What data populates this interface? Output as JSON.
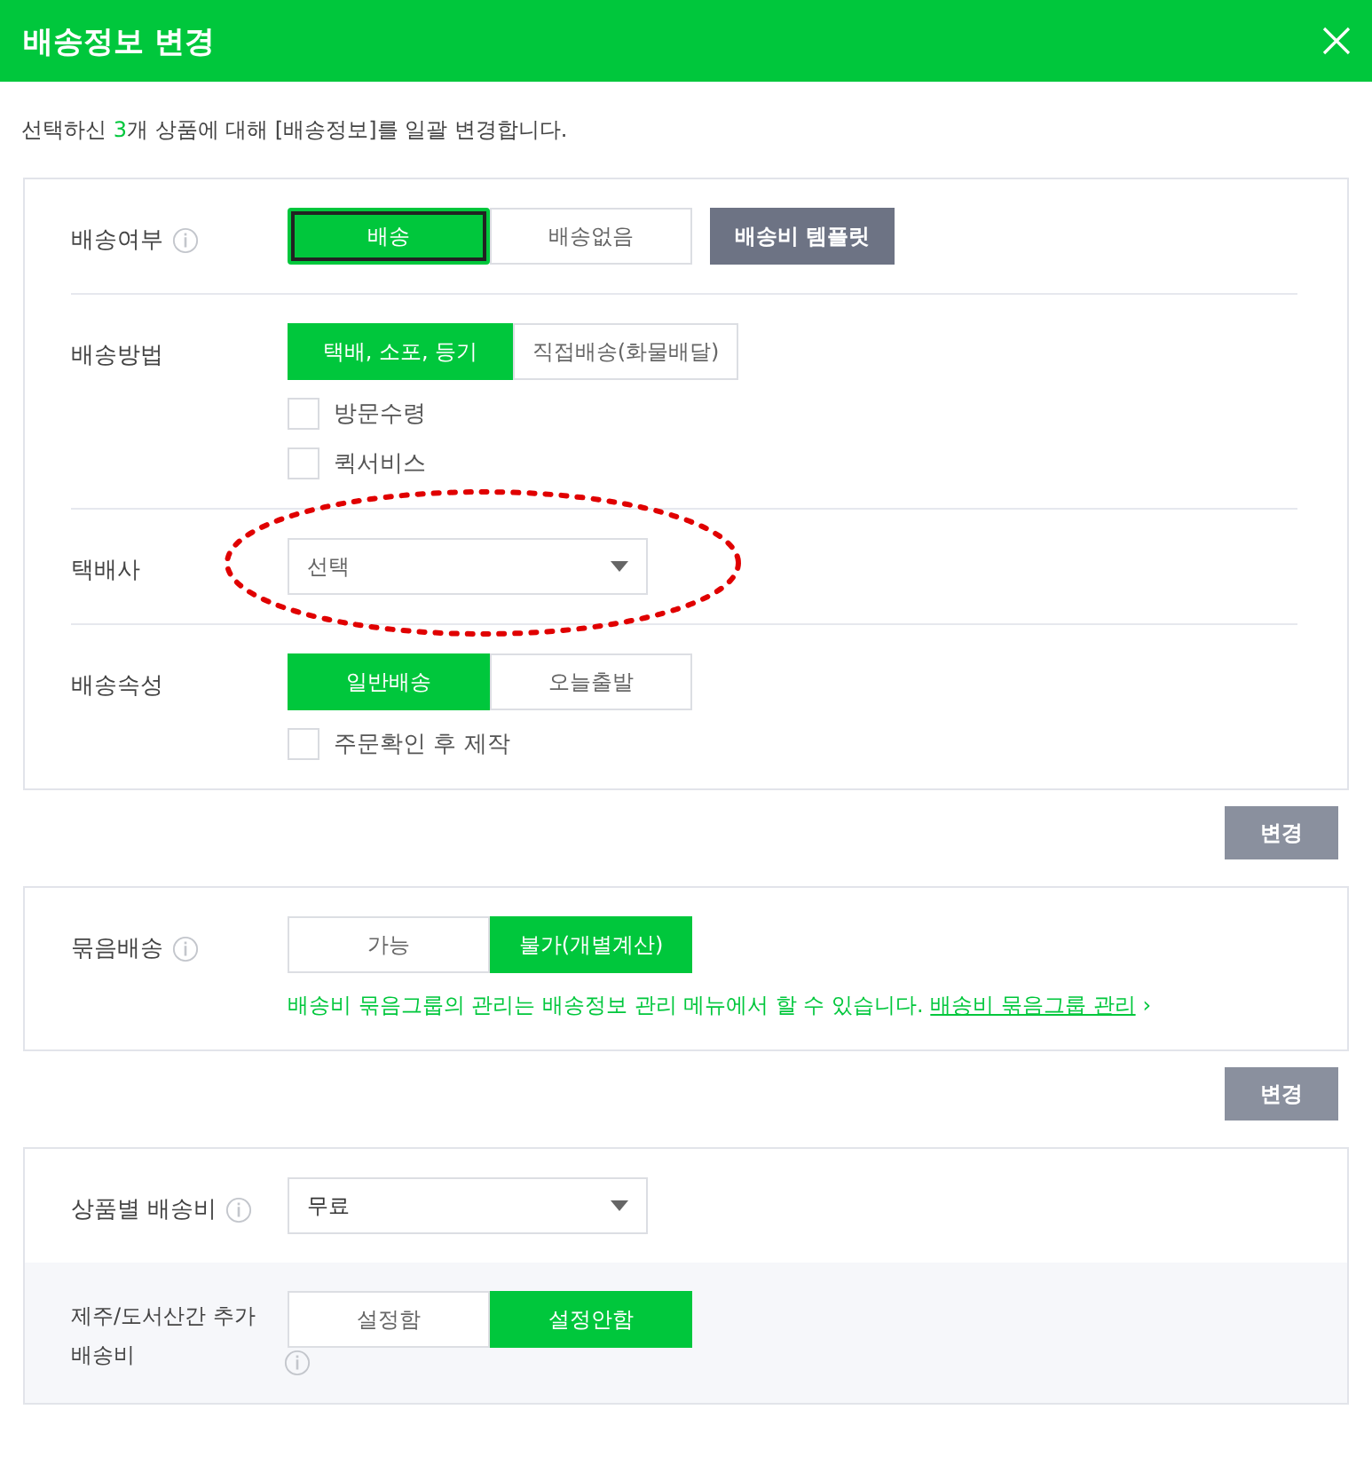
{
  "dialog": {
    "title": "배송정보 변경",
    "intro": {
      "before": "선택하신 ",
      "count": "3",
      "after": "개 상품에 대해 [배송정보]를 일괄 변경합니다."
    },
    "sections": [
      {
        "rows": [
          {
            "kind": "segmented",
            "label": "배송여부",
            "info": true,
            "options": [
              {
                "label": "배송",
                "selected": true,
                "focused": true
              },
              {
                "label": "배송없음",
                "selected": false,
                "focused": false
              }
            ],
            "extra_button": "배송비 템플릿"
          },
          {
            "kind": "segmented",
            "label": "배송방법",
            "info": false,
            "options": [
              {
                "label": "택배, 소포, 등기",
                "selected": true,
                "focused": false
              },
              {
                "label": "직접배송(화물배달)",
                "selected": false,
                "focused": false
              }
            ],
            "checkboxes": [
              {
                "label": "방문수령",
                "checked": false
              },
              {
                "label": "퀵서비스",
                "checked": false
              }
            ]
          },
          {
            "kind": "select",
            "label": "택배사",
            "info": false,
            "value": "선택",
            "placeholder_style": true,
            "highlighted": true
          },
          {
            "kind": "segmented",
            "label": "배송속성",
            "info": false,
            "options": [
              {
                "label": "일반배송",
                "selected": true,
                "focused": false
              },
              {
                "label": "오늘출발",
                "selected": false,
                "focused": false
              }
            ],
            "checkboxes": [
              {
                "label": "주문확인 후 제작",
                "checked": false
              }
            ]
          }
        ],
        "change_button": "변경"
      },
      {
        "rows": [
          {
            "kind": "segmented",
            "label": "묶음배송",
            "info": true,
            "options": [
              {
                "label": "가능",
                "selected": false,
                "focused": false
              },
              {
                "label": "불가(개별계산)",
                "selected": true,
                "focused": false
              }
            ],
            "note": {
              "text": "배송비 묶음그룹의 관리는 배송정보 관리 메뉴에서 할 수 있습니다.",
              "link": "배송비 묶음그룹 관리",
              "arrow": "›"
            }
          }
        ],
        "change_button": "변경"
      },
      {
        "rows": [
          {
            "kind": "select",
            "label": "상품별 배송비",
            "info": true,
            "value": "무료",
            "placeholder_style": false,
            "highlighted": false
          },
          {
            "kind": "segmented",
            "label": "제주/도서산간 추가 배송비",
            "info": true,
            "shaded": true,
            "options": [
              {
                "label": "설정함",
                "selected": false,
                "focused": false
              },
              {
                "label": "설정안함",
                "selected": true,
                "focused": false
              }
            ]
          }
        ]
      }
    ]
  }
}
